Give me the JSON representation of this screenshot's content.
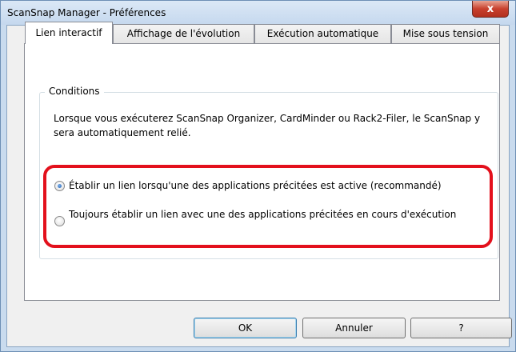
{
  "window": {
    "title": "ScanSnap Manager - Préférences",
    "close_glyph": "x"
  },
  "tabs": [
    {
      "label": "Lien interactif",
      "active": true
    },
    {
      "label": "Affichage de l'évolution",
      "active": false
    },
    {
      "label": "Exécution automatique",
      "active": false
    },
    {
      "label": "Mise sous tension",
      "active": false
    }
  ],
  "conditions": {
    "group_label": "Conditions",
    "description": "Lorsque vous exécuterez ScanSnap Organizer, CardMinder ou Rack2-Filer, le ScanSnap y sera automatiquement relié.",
    "options": [
      {
        "label": "Établir un lien lorsqu'une des applications précitées est active (recommandé)",
        "checked": true
      },
      {
        "label": "Toujours établir un lien avec une des applications précitées en cours d'exécution",
        "checked": false
      }
    ]
  },
  "buttons": {
    "ok": "OK",
    "cancel": "Annuler",
    "help": "?"
  },
  "colors": {
    "highlight": "#e3101c",
    "title_bar": "#c5d8ee"
  }
}
